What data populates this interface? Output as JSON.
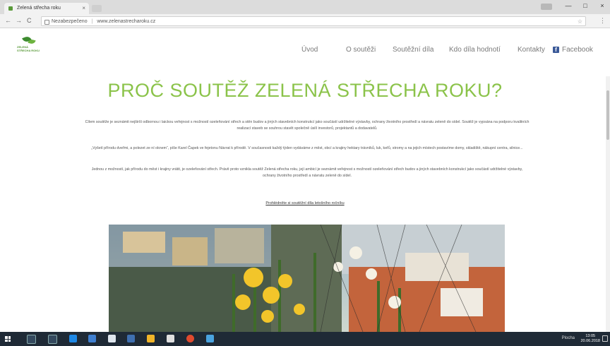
{
  "browser": {
    "tab_title": "Zelená střecha roku",
    "tab_close": "×",
    "window_controls": {
      "minimize": "—",
      "maximize": "□",
      "close": "×"
    },
    "nav": {
      "back": "←",
      "forward": "→",
      "reload": "C"
    },
    "address": {
      "security_label": "Nezabezpečeno",
      "url": "www.zelenastrecharoku.cz"
    },
    "menu_glyph": "⋮",
    "bookmark_glyph": "☆"
  },
  "site": {
    "logo_text": "ZELENÁ STŘECHA ROKU",
    "nav_items": [
      "Úvod",
      "O soutěži",
      "Soutěžní díla",
      "Kdo díla hodnotí",
      "Kontakty",
      "Facebook"
    ],
    "facebook_glyph": "f",
    "title": "PROČ SOUTĚŽ ZELENÁ STŘECHA ROKU?",
    "paragraphs": [
      "Cílem soutěže je seznámit nejširší odbornou i laickou veřejnost s možností ozeleňování střech a stěn budov a jiných stavebních konstrukcí jako součástí udržitelné výstavby, ochrany životního prostředí a návratu zeleně do sídel. Soutěž je vypsána na podporu kvalitních realizací staveb se souhrou stavět společně úsilí investorů, projektantů a dodavatelů.",
      "„Vyšetí přírodu dveřmi, a polezet ze ní oknem“, píše Karel Čapek ve fejetonu Návrat k přírodě. V současnosti každý týden vydáváme z měst, obcí a krajiny hektary trávníků, luk, keřů, stromy a na jejich místech postavíme domy, skladiště, nákupní centra, silnice...",
      "Jednou z možností, jak přírodu do měst i krajiny vrátit, je ozeleňování střech. Právě proto vznikla soutěž Zelená střecha roku, její ambicí je seznámit veřejnost s možností ozeleňování střech budov a jiných stavebních konstrukcí jako součástí udržitelné výstavby, ochrany životního prostředí a návratu zeleně do sídel."
    ],
    "more_link": "Prohlédněte si soutěžní díla letošního ročníku"
  },
  "taskbar": {
    "tray_text": "Plocha",
    "clock_time": "13:05",
    "clock_date": "20.06.2018"
  },
  "colors": {
    "accent_green": "#8bc34a",
    "logo_green": "#5a9a3a",
    "facebook_blue": "#3b5998",
    "taskbar": "#1f2a36"
  }
}
